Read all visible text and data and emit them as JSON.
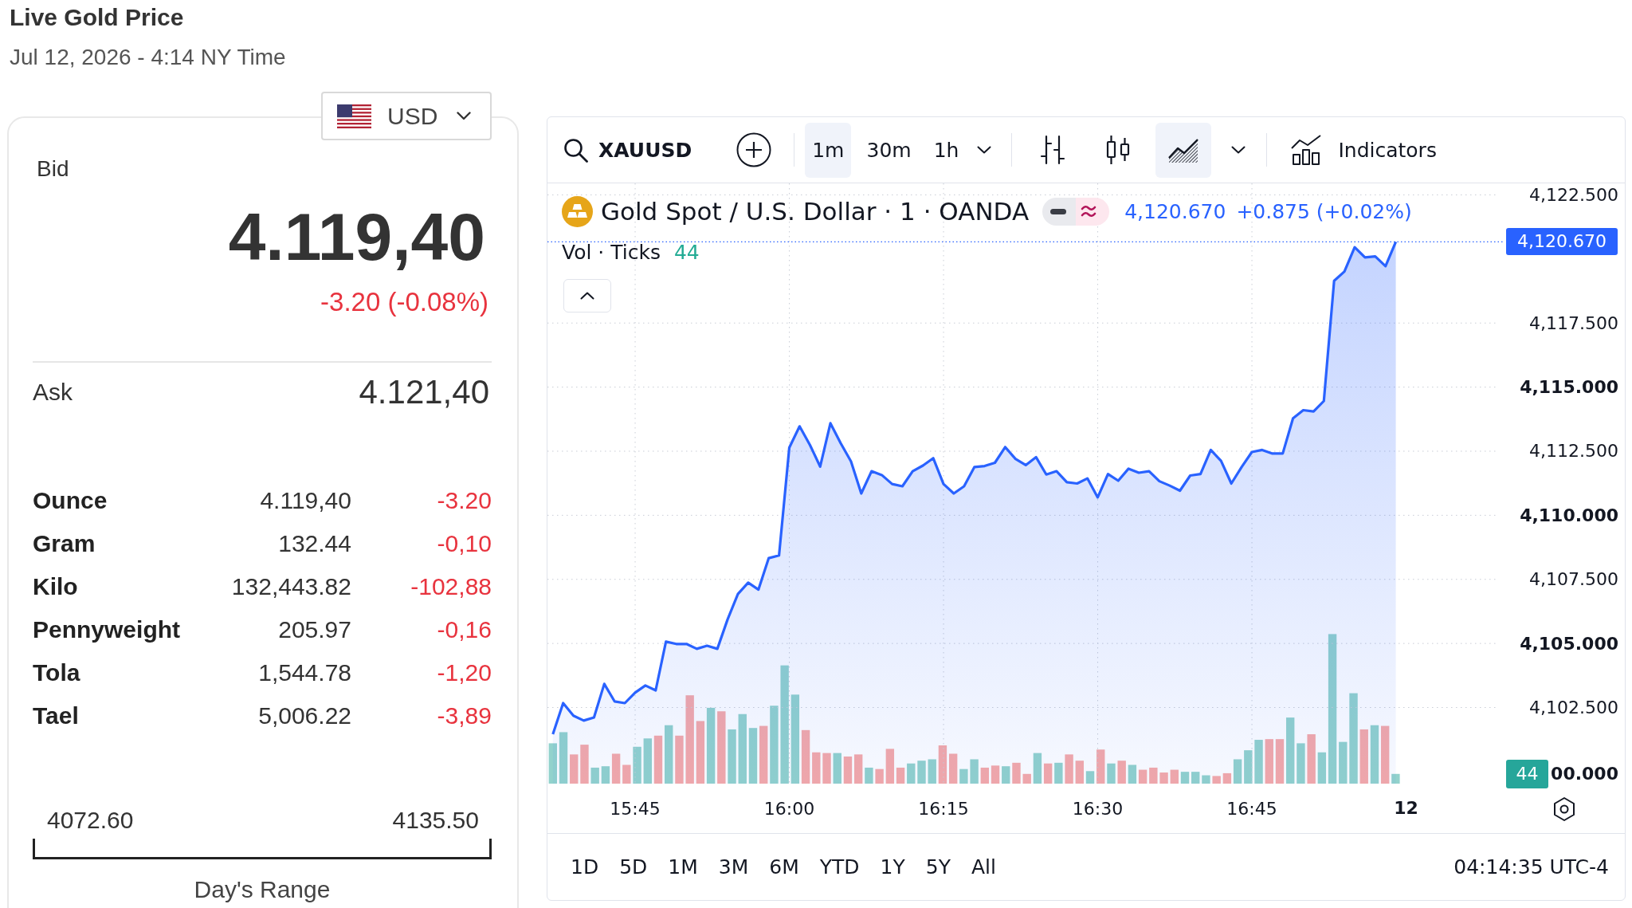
{
  "header": {
    "title": "Live Gold Price",
    "timestamp": "Jul 12, 2026 - 4:14 NY Time"
  },
  "quote_panel": {
    "currency": "USD",
    "bid": {
      "label": "Bid",
      "price": "4.119,40",
      "change": "-3.20 (-0.08%)",
      "falling": true
    },
    "ask": {
      "label": "Ask",
      "price": "4.121,40"
    },
    "units": [
      {
        "name": "Ounce",
        "price": "4.119,40",
        "change": "-3.20",
        "falling": true
      },
      {
        "name": "Gram",
        "price": "132.44",
        "change": "-0,10",
        "falling": true
      },
      {
        "name": "Kilo",
        "price": "132,443.82",
        "change": "-102,88",
        "falling": true
      },
      {
        "name": "Pennyweight",
        "price": "205.97",
        "change": "-0,16",
        "falling": true
      },
      {
        "name": "Tola",
        "price": "1,544.78",
        "change": "-1,20",
        "falling": true
      },
      {
        "name": "Tael",
        "price": "5,006.22",
        "change": "-3,89",
        "falling": true
      }
    ],
    "day_range": {
      "low": "4072.60",
      "high": "4135.50",
      "label": "Day's Range"
    }
  },
  "chart_panel": {
    "toolbar": {
      "symbol": "XAUUSD",
      "intervals": [
        {
          "label": "1m",
          "selected": true
        },
        {
          "label": "30m",
          "selected": false
        },
        {
          "label": "1h",
          "selected": false
        }
      ],
      "chart_types": [
        {
          "kind": "bars",
          "selected": false
        },
        {
          "kind": "candles",
          "selected": false
        },
        {
          "kind": "area",
          "selected": true
        }
      ],
      "indicators_label": "Indicators"
    },
    "legend": {
      "title": "Gold Spot / U.S. Dollar · 1 · OANDA",
      "price": "4,120.670",
      "change": "+0.875 (+0.02%)",
      "volume_label": "Vol · Ticks",
      "volume_value": "44"
    },
    "chart_data": {
      "type": "area",
      "x": [
        937,
        938,
        939,
        940,
        941,
        942,
        943,
        944,
        945,
        946,
        947,
        948,
        949,
        950,
        951,
        952,
        953,
        954,
        955,
        956,
        957,
        958,
        959,
        960,
        961,
        962,
        963,
        964,
        965,
        966,
        967,
        968,
        969,
        970,
        971,
        972,
        973,
        974,
        975,
        976,
        977,
        978,
        979,
        980,
        981,
        982,
        983,
        984,
        985,
        986,
        987,
        988,
        989,
        990,
        991,
        992,
        993,
        994,
        995,
        996,
        997,
        998,
        999,
        1000,
        1001,
        1002,
        1003,
        1004,
        1005,
        1006,
        1007,
        1008,
        1009,
        1010,
        1011,
        1012,
        1013,
        1014,
        1015,
        1016,
        1017,
        1018,
        1019
      ],
      "series": [
        {
          "color": "#2962ff",
          "values": [
            4101.46,
            4102.67,
            4102.18,
            4101.99,
            4102.11,
            4103.42,
            4102.74,
            4102.67,
            4103.08,
            4103.36,
            4103.17,
            4105.07,
            4104.98,
            4104.98,
            4104.79,
            4104.91,
            4104.79,
            4105.94,
            4106.93,
            4107.37,
            4107.1,
            4108.33,
            4108.43,
            4112.64,
            4113.47,
            4112.75,
            4111.9,
            4113.59,
            4112.81,
            4112.1,
            4110.85,
            4111.72,
            4111.57,
            4111.22,
            4111.13,
            4111.72,
            4111.94,
            4112.23,
            4111.22,
            4110.85,
            4111.13,
            4111.88,
            4111.92,
            4112.05,
            4112.66,
            4112.2,
            4111.96,
            4112.27,
            4111.59,
            4111.72,
            4111.29,
            4111.24,
            4111.44,
            4110.7,
            4111.61,
            4111.35,
            4111.82,
            4111.66,
            4111.72,
            4111.33,
            4111.16,
            4110.96,
            4111.55,
            4111.61,
            4112.55,
            4112.12,
            4111.24,
            4111.88,
            4112.47,
            4112.55,
            4112.41,
            4112.41,
            4113.78,
            4114.1,
            4114.05,
            4114.46,
            4119.15,
            4119.51,
            4120.46,
            4120.06,
            4120.1,
            4119.72,
            4120.67
          ]
        }
      ],
      "xlim": [
        936.47,
        1028.95
      ],
      "ylim": [
        4099.53,
        4122.95
      ],
      "xticks": [
        {
          "value": 945,
          "label": "15:45"
        },
        {
          "value": 960,
          "label": "16:00"
        },
        {
          "value": 975,
          "label": "16:15"
        },
        {
          "value": 990,
          "label": "16:30"
        },
        {
          "value": 1005,
          "label": "16:45"
        }
      ],
      "yticks": [
        {
          "value": 4102.5,
          "label": "4,102.500"
        },
        {
          "value": 4105,
          "label": "4,105.000"
        },
        {
          "value": 4107.5,
          "label": "4,107.500"
        },
        {
          "value": 4110,
          "label": "4,110.000"
        },
        {
          "value": 4112.5,
          "label": "4,112.500"
        },
        {
          "value": 4115,
          "label": "4,115.000"
        },
        {
          "value": 4117.5,
          "label": "4,117.500"
        },
        {
          "value": 4122.5,
          "label": "4,122.500"
        }
      ],
      "grid": true
    },
    "time_axis_day_label": "12",
    "scale_labels": [
      {
        "kind": "last_price",
        "text": "4,120.670"
      },
      {
        "kind": "volume",
        "text": "44",
        "partial_tick_label": "00.000"
      }
    ],
    "ranges": [
      "1D",
      "5D",
      "1M",
      "3M",
      "6M",
      "YTD",
      "1Y",
      "5Y",
      "All"
    ],
    "clock": "04:14:35 UTC-4"
  }
}
